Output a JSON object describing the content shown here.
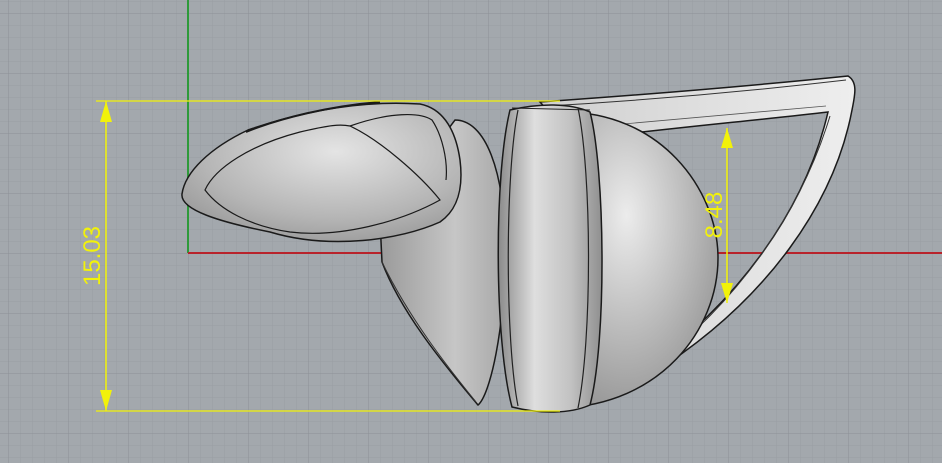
{
  "viewport": {
    "background": "#a3a8ad",
    "grid_minor_color": "#999ea3",
    "grid_major_color": "#8c9196",
    "x_axis_color": "#b8232b",
    "y_axis_color": "#2e9a3a"
  },
  "model": {
    "shade_light": "#e6e6e6",
    "shade_mid": "#b4b4b4",
    "shade_dark": "#8a8a8a",
    "edge_color": "#1a1a1a"
  },
  "dimensions": {
    "color": "#f2f20a",
    "overall_height": "15.03",
    "inner_height": "8.48"
  }
}
